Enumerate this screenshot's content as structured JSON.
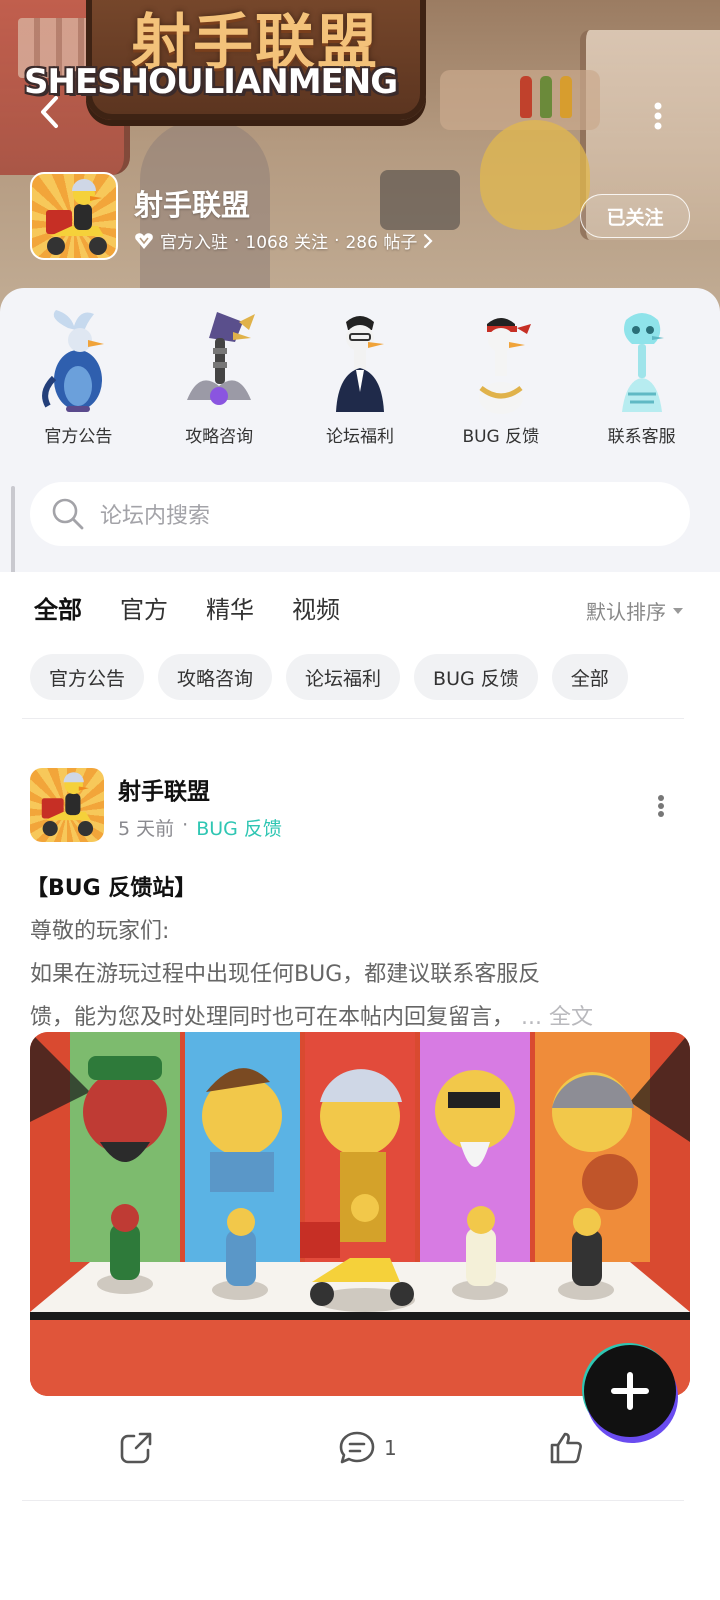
{
  "banner": {
    "sign_title": "射手联盟",
    "sign_subtitle": "SHESHOULIANMENG"
  },
  "forum": {
    "name": "射手联盟",
    "badge_label": "官方入驻",
    "followers": "1068 关注",
    "posts": "286 帖子",
    "separator": "·",
    "follow_button_label": "已关注"
  },
  "categories": [
    {
      "label": "官方公告",
      "icon": "peacock-bird-icon"
    },
    {
      "label": "攻略咨询",
      "icon": "robot-bird-icon"
    },
    {
      "label": "论坛福利",
      "icon": "goose-suit-icon"
    },
    {
      "label": "BUG 反馈",
      "icon": "goose-headband-icon"
    },
    {
      "label": "联系客服",
      "icon": "ghost-skeleton-icon"
    }
  ],
  "search": {
    "placeholder": "论坛内搜索"
  },
  "tabs": [
    {
      "label": "全部",
      "active": true
    },
    {
      "label": "官方",
      "active": false
    },
    {
      "label": "精华",
      "active": false
    },
    {
      "label": "视频",
      "active": false
    }
  ],
  "sort_label": "默认排序",
  "chips": [
    "官方公告",
    "攻略咨询",
    "论坛福利",
    "BUG 反馈",
    "全部"
  ],
  "post": {
    "author": "射手联盟",
    "time": "5 天前",
    "dot": "·",
    "category": "BUG 反馈",
    "title": "【BUG 反馈站】",
    "body_lines": [
      "尊敬的玩家们:",
      " 如果在游玩过程中出现任何BUG，都建议联系客服反",
      "馈，能为您及时处理同时也可在本帖内回复留言，"
    ],
    "more_text": "... 全文",
    "comment_count": "1"
  },
  "colors": {
    "accent": "#2fc6b3",
    "sheet_bg": "#f3f4f8",
    "image_bg": "#d94a30"
  }
}
